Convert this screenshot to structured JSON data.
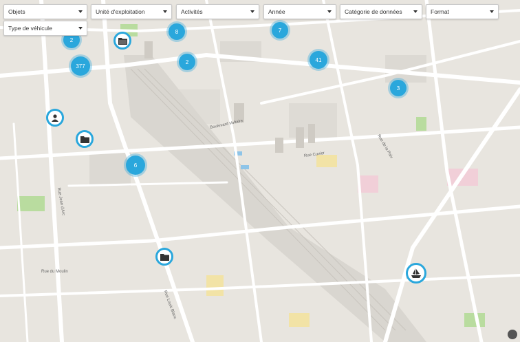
{
  "filters": [
    {
      "label": "Objets"
    },
    {
      "label": "Unité d'exploitation"
    },
    {
      "label": "Activités"
    },
    {
      "label": "Année"
    },
    {
      "label": "Catégorie de données"
    },
    {
      "label": "Format"
    },
    {
      "label": "Type de véhicule"
    }
  ],
  "clusters": [
    {
      "count": "2"
    },
    {
      "count": "8"
    },
    {
      "count": "7"
    },
    {
      "count": "377"
    },
    {
      "count": "2"
    },
    {
      "count": "41"
    },
    {
      "count": "3"
    },
    {
      "count": "6"
    }
  ],
  "markers": [
    {
      "icon": "folder-icon"
    },
    {
      "icon": "person-icon"
    },
    {
      "icon": "folder-icon"
    },
    {
      "icon": "folder-icon"
    },
    {
      "icon": "ship-icon"
    }
  ],
  "street_labels": [
    {
      "text": "Boulevard Voltaire"
    },
    {
      "text": "Rue Cuvier"
    },
    {
      "text": "Rue du Moulin"
    },
    {
      "text": "Rue Jean d'Arc"
    },
    {
      "text": "Rue Louis Blanc"
    },
    {
      "text": "Rue de la Paix"
    }
  ],
  "colors": {
    "accent": "#2aa7dc",
    "road": "#ffffff",
    "land": "#e8e5df",
    "park": "#b9dc9f"
  }
}
